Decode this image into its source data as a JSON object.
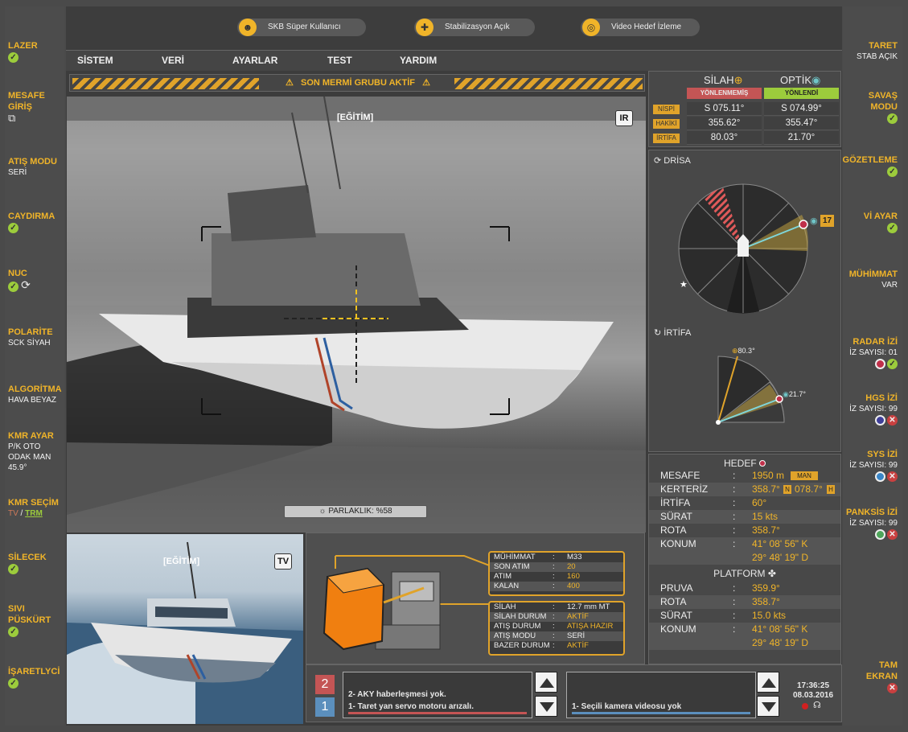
{
  "top": {
    "user": "SKB Süper Kullanıcı",
    "stab": "Stabilizasyon Açık",
    "video": "Video Hedef İzleme"
  },
  "menu": [
    "SİSTEM",
    "VERİ",
    "AYARLAR",
    "TEST",
    "YARDIM"
  ],
  "warning": "SON MERMİ GRUBU AKTİF",
  "ir": {
    "mode": "IR",
    "training": "[EĞİTİM]",
    "brightness": "PARLAKLIK: %58"
  },
  "tv": {
    "mode": "TV",
    "training": "[EĞİTİM]"
  },
  "left": {
    "lazer": "LAZER",
    "mesafe1": "MESAFE",
    "mesafe2": "GİRİŞ",
    "atis": "ATIŞ MODU",
    "atis_val": "SERİ",
    "caydirma": "CAYDIRMA",
    "nuc": "NUC",
    "polarite": "POLARİTE",
    "polarite_val": "SCK SİYAH",
    "algoritma": "ALGORİTMA",
    "algoritma_val": "HAVA BEYAZ",
    "kmr": "KMR AYAR",
    "kmr_v1": "P/K OTO",
    "kmr_v2": "ODAK MAN",
    "kmr_v3": "45.9°",
    "kmrsec": "KMR SEÇİM",
    "kmr_tv": "TV",
    "kmr_sep": " / ",
    "kmr_trm": "TRM",
    "silecek": "SİLECEK",
    "sivi1": "SIVI",
    "sivi2": "PÜSKÜRT",
    "isaret": "İŞARETLYCİ"
  },
  "right": {
    "taret": "TARET",
    "taret_val": "STAB AÇIK",
    "savas1": "SAVAŞ",
    "savas2": "MODU",
    "gozet": "GÖZETLEME",
    "viayar": "Vİ AYAR",
    "muh": "MÜHİMMAT",
    "muh_val": "VAR",
    "radar": "RADAR İZİ",
    "radar_val": "İZ SAYISI: 01",
    "hgs": "HGS İZİ",
    "hgs_val": "İZ SAYISI: 99",
    "sys": "SYS İZİ",
    "sys_val": "İZ SAYISI: 99",
    "panksis": "PANKSİS İZİ",
    "panksis_val": "İZ SAYISI: 99",
    "tam1": "TAM",
    "tam2": "EKRAN"
  },
  "status": {
    "silah": "SİLAH",
    "optik": "OPTİK",
    "silah_state": "YÖNLENMEMİŞ",
    "optik_state": "YÖNLENDİ",
    "rows": [
      {
        "tag": "NİSPİ",
        "silah": "S 075.11°",
        "optik": "S 074.99°"
      },
      {
        "tag": "HAKİKİ",
        "silah": "355.62°",
        "optik": "355.47°"
      },
      {
        "tag": "İRTİFA",
        "silah": "80.03°",
        "optik": "21.70°"
      }
    ]
  },
  "radar": {
    "drisa": "DRİSA",
    "irtifa": "İRTİFA",
    "target_id": "17",
    "irt_silah": "80.3°",
    "irt_optik": "21.7°"
  },
  "hedef": {
    "title": "HEDEF",
    "mesafe_k": "MESAFE",
    "mesafe_v": "1950 m",
    "man": "MAN",
    "kerteriz_k": "KERTERİZ",
    "kerteriz_v1": "358.7°",
    "kerteriz_n": "N",
    "kerteriz_v2": "078.7°",
    "kerteriz_h": "H",
    "irtifa_k": "İRTİFA",
    "irtifa_v": "60°",
    "surat_k": "SÜRAT",
    "surat_v": "15 kts",
    "rota_k": "ROTA",
    "rota_v": "358.7°",
    "konum_k": "KONUM",
    "konum_v1": "41° 08' 56\" K",
    "konum_v2": "29° 48' 19\" D",
    "colon": ":"
  },
  "platform": {
    "title": "PLATFORM",
    "pruva_k": "PRUVA",
    "pruva_v": "359.9°",
    "rota_k": "ROTA",
    "rota_v": "358.7°",
    "surat_k": "SÜRAT",
    "surat_v": "15.0 kts",
    "konum_k": "KONUM",
    "konum_v1": "41° 08' 56\" K",
    "konum_v2": "29° 48' 19\" D"
  },
  "ammo": {
    "r1k": "MÜHİMMAT",
    "r1v": "M33",
    "r2k": "SON ATIM",
    "r2v": "20",
    "r3k": "ATIM",
    "r3v": "160",
    "r4k": "KALAN",
    "r4v": "400"
  },
  "gun": {
    "r1k": "SİLAH",
    "r1v": "12.7 mm MT",
    "r2k": "SİLAH DURUM",
    "r2v": "AKTİF",
    "r3k": "ATIŞ DURUM",
    "r3v": "ATIŞA HAZIR",
    "r4k": "ATIŞ MODU",
    "r4v": "SERİ",
    "r5k": "BAZER DURUM",
    "r5v": "AKTİF"
  },
  "messages": {
    "count2": "2",
    "count1": "1",
    "m2": "2- AKY haberleşmesi yok.",
    "m1": "1- Taret yan servo motoru arızalı.",
    "cam": "1- Seçili kamera videosu yok",
    "time": "17:36:25",
    "date": "08.03.2016"
  },
  "colors": {
    "accent": "#f0b429",
    "ok": "#9ccc3c",
    "bad": "#c94040",
    "teal": "#6fc5c7"
  }
}
